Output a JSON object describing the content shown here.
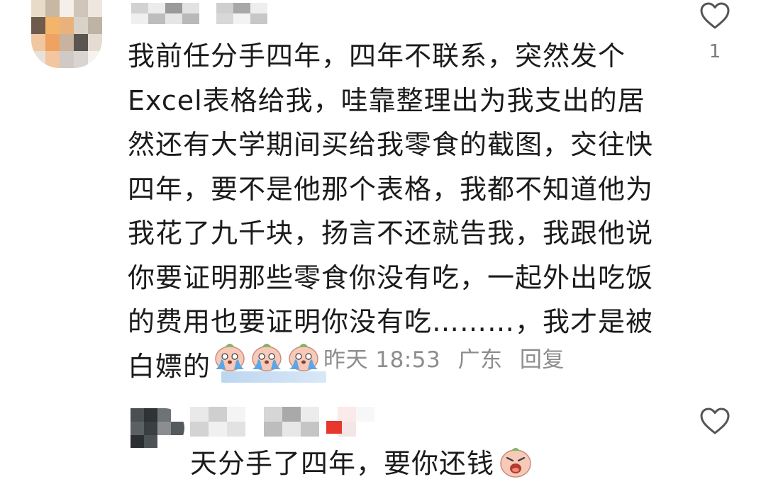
{
  "comment": {
    "lines": [
      "我前任分手四年，四年不联系，突然发个",
      "Excel表格给我，哇靠整理出为我支出的居",
      "然还有大学期间买给我零食的截图，交往快",
      "四年，要不是他那个表格，我都不知道他为",
      "我花了九千块，扬言不还就告我，我跟他说",
      "你要证明那些零食你没有吃，一起外出吃饭",
      "的费用也要证明你没有吃………，我才是被",
      "白嫖的"
    ],
    "emoji_icon": "crying-emoji-icon",
    "time": "昨天 18:53",
    "location": "广东",
    "reply_label": "回复",
    "like_count": "1"
  },
  "reply": {
    "text": "天分手了四年，要你还钱",
    "emoji_icon": "angry-emoji-icon"
  },
  "colors": {
    "text": "#1b1b1b",
    "meta": "#8d8d8d",
    "like_icon": "#555555",
    "badge": "#e8372e"
  },
  "icons": {
    "like": "heart-outline-icon"
  }
}
